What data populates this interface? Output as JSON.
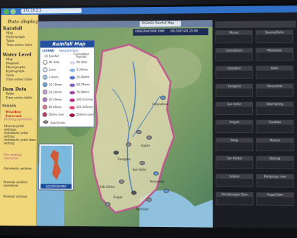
{
  "browser": {
    "url": "172.16.2.1",
    "tab_label": "PAGASA Rainfall Map"
  },
  "sidebar": {
    "header": "Data display",
    "rainfall": {
      "title": "Rainfall",
      "items": [
        "Map",
        "Hydrograph",
        "Table",
        "Time series table"
      ]
    },
    "water_level": {
      "title": "Water Level",
      "items": [
        "Map",
        "Diagram",
        "Photographs",
        "Hydrograph",
        "Table",
        "Time series table"
      ]
    },
    "dam_data": {
      "title": "Dam Data",
      "items": [
        "Table",
        "Time series table"
      ]
    },
    "pagasa": "PAGASA",
    "weather_forecast": "Weather Forecast",
    "printing_header": "Printing operation",
    "printing_items": [
      "Manual print settings",
      "Automatic print setting",
      "Automatic print time setting"
    ],
    "file_making_header": "File making operation",
    "file_items": [
      "Automatic archive",
      "Manual archive operation",
      "Manual archive"
    ]
  },
  "map": {
    "title": "Rainfall Map",
    "observation_label": "OBSERVATION TIME",
    "observation_time": "2015/07/24 15:00",
    "legend": {
      "header": "LEGEND",
      "subheader": "Sampled Data",
      "col_left": "1H Rainfall",
      "col_right": "Cumulative Rainfall",
      "left_rows": [
        "No data",
        "1mm",
        "2-9mm",
        "10-19mm",
        "20-29mm",
        "30-39mm",
        "40-49mm",
        "50mm over"
      ],
      "right_rows": [
        "No data",
        "1-24mm",
        "25-49mm",
        "50-74mm",
        "75-99mm",
        "100-124mm",
        "125-149mm",
        "150mm over"
      ],
      "sub_center": "Sub Center"
    },
    "location_map_label": "LOCATION MAP",
    "places": [
      "Sub Center",
      "Zaragoza",
      "Cabanatuan",
      "Gapan",
      "San Isidro",
      "Penaranda",
      "Arayat",
      "Sasmuan"
    ]
  },
  "right_panel": {
    "stations": [
      {
        "name": "Munoz"
      },
      {
        "name": "Sapang Buho"
      },
      {
        "name": "Cabanatuan"
      },
      {
        "name": "Mayapyap"
      },
      {
        "name": "Gabaldon"
      },
      {
        "name": "Palali"
      },
      {
        "name": "Zaragoza"
      },
      {
        "name": "Penaranda"
      },
      {
        "name": "San Isidro"
      },
      {
        "name": "Sibul Spring"
      },
      {
        "name": "Arayat"
      },
      {
        "name": "Candaba"
      },
      {
        "name": "Pasig"
      },
      {
        "name": "Mexico"
      },
      {
        "name": "San Rafael"
      },
      {
        "name": "Baliuag"
      },
      {
        "name": "Sulipan"
      },
      {
        "name": "Pampanga river"
      },
      {
        "name": "Pantabangan Dam"
      },
      {
        "name": "Angat Dam"
      }
    ]
  },
  "colors": {
    "sidebar_bg": "#f0d77a",
    "legend_header": "#1b4a9a",
    "basin_outline": "#c0578f"
  }
}
